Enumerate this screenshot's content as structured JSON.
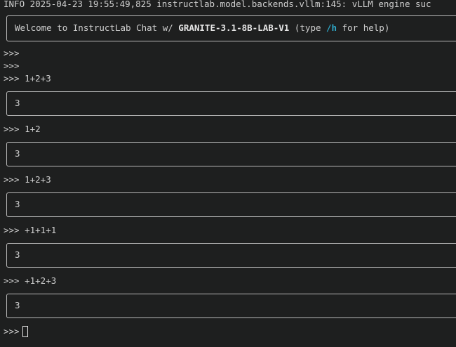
{
  "log_line": "INFO 2025-04-23 19:55:49,825 instructlab.model.backends.vllm:145: vLLM engine suc",
  "welcome": {
    "prefix": "Welcome to InstructLab Chat w/ ",
    "model": "GRANITE-3.1-8B-LAB-V1",
    "mid": " (type ",
    "command": "/h",
    "suffix": " for help)"
  },
  "prompt": ">>>",
  "history": [
    {
      "input": "",
      "output": null
    },
    {
      "input": "",
      "output": null
    },
    {
      "input": "1+2+3",
      "output": "3"
    },
    {
      "input": "1+2",
      "output": "3"
    },
    {
      "input": "1+2+3",
      "output": "3"
    },
    {
      "input": "+1+1+1",
      "output": "3"
    },
    {
      "input": "+1+2+3",
      "output": "3"
    }
  ],
  "current_input": ""
}
